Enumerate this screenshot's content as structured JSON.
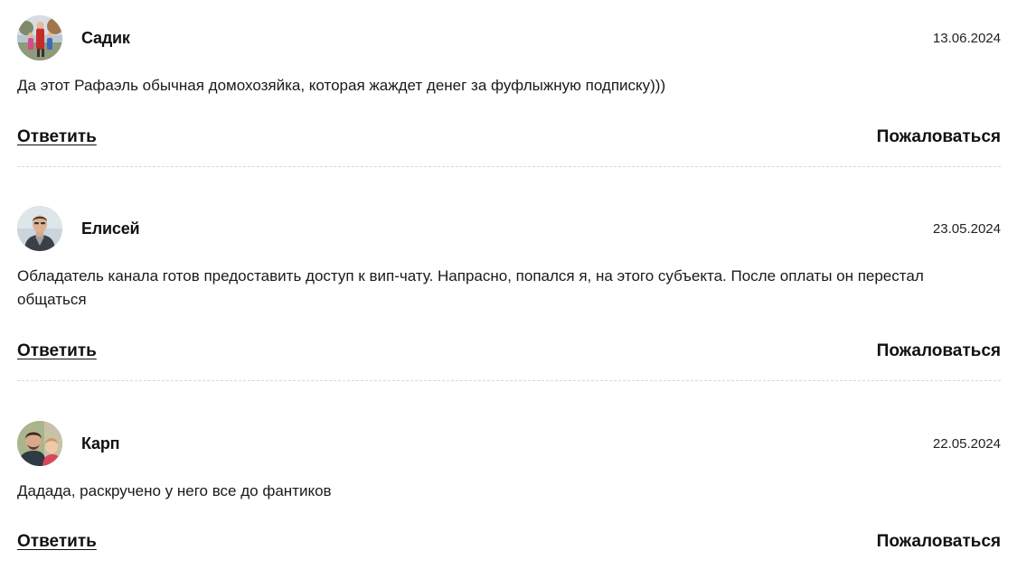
{
  "comments": [
    {
      "author": "Садик",
      "date": "13.06.2024",
      "text": "Да этот Рафаэль обычная домохозяйка, которая жаждет денег за фуфлыжную подписку)))",
      "reply_label": "Ответить",
      "report_label": "Пожаловаться"
    },
    {
      "author": "Елисей",
      "date": "23.05.2024",
      "text": "Обладатель канала готов предоставить доступ к вип-чату. Напрасно, попался я, на этого субъекта. После оплаты он перестал общаться",
      "reply_label": "Ответить",
      "report_label": "Пожаловаться"
    },
    {
      "author": "Карп",
      "date": "22.05.2024",
      "text": "Дадада, раскручено у него все до фантиков",
      "reply_label": "Ответить",
      "report_label": "Пожаловаться"
    }
  ]
}
